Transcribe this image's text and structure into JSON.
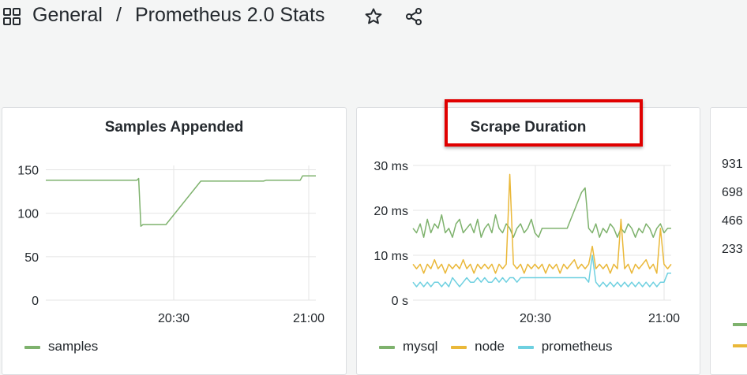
{
  "breadcrumb": {
    "folder": "General",
    "separator": "/",
    "dashboard": "Prometheus 2.0 Stats"
  },
  "colors": {
    "mysql": "#7eb26d",
    "node": "#eab839",
    "prometheus": "#6ed0e0",
    "samples": "#7eb26d",
    "highlight": "#e00000"
  },
  "panels": {
    "samples": {
      "title": "Samples Appended",
      "legend": [
        "samples"
      ],
      "chart_data": {
        "type": "line",
        "x_ticks": [
          "20:30",
          "21:00"
        ],
        "y_ticks": [
          "0",
          "50",
          "100",
          "150"
        ],
        "ylim": [
          0,
          155
        ],
        "series": [
          {
            "name": "samples",
            "points": [
              [
                0,
                138
              ],
              [
                0.337,
                138
              ],
              [
                0.344,
                140
              ],
              [
                0.352,
                85
              ],
              [
                0.36,
                87
              ],
              [
                0.445,
                87
              ],
              [
                0.574,
                137
              ],
              [
                0.806,
                137
              ],
              [
                0.816,
                138
              ],
              [
                0.942,
                138
              ],
              [
                0.951,
                143
              ],
              [
                1,
                143
              ]
            ]
          }
        ]
      }
    },
    "scrape": {
      "title": "Scrape Duration",
      "legend": [
        "mysql",
        "node",
        "prometheus"
      ],
      "chart_data": {
        "type": "line",
        "x_ticks": [
          "20:30",
          "21:00"
        ],
        "y_ticks": [
          "0 s",
          "10 ms",
          "20 ms",
          "30 ms"
        ],
        "ylim": [
          0,
          30
        ],
        "series": [
          {
            "name": "mysql",
            "values": [
              16,
              15,
              17,
              14,
              18,
              15,
              17,
              16,
              19,
              15,
              16,
              14,
              17,
              18,
              15,
              16,
              17,
              15,
              18,
              14,
              16,
              17,
              15,
              19,
              16,
              15,
              17,
              16,
              14,
              16,
              17,
              15,
              16,
              18,
              15,
              14,
              16,
              16,
              16,
              16,
              16,
              16,
              16,
              16,
              18,
              20,
              22,
              24,
              25,
              16,
              15,
              17,
              14,
              16,
              15,
              17,
              16,
              14,
              16,
              15,
              17,
              16,
              14,
              16,
              15,
              17,
              16,
              14,
              16,
              17,
              15,
              16,
              16
            ]
          },
          {
            "name": "node",
            "values": [
              8,
              7,
              8,
              6,
              8,
              7,
              9,
              7,
              8,
              6,
              8,
              7,
              8,
              7,
              9,
              7,
              8,
              6,
              8,
              7,
              8,
              7,
              8,
              6,
              8,
              7,
              8,
              28,
              8,
              7,
              8,
              6,
              8,
              7,
              8,
              7,
              8,
              6,
              8,
              7,
              8,
              6,
              8,
              7,
              8,
              9,
              7,
              8,
              7,
              8,
              12,
              7,
              8,
              7,
              8,
              6,
              8,
              7,
              18,
              7,
              8,
              6,
              8,
              7,
              8,
              9,
              7,
              8,
              6,
              16,
              8,
              7,
              8
            ]
          },
          {
            "name": "prometheus",
            "values": [
              4,
              3,
              4,
              3,
              4,
              3,
              4,
              4,
              3,
              4,
              3,
              5,
              4,
              3,
              4,
              5,
              4,
              4,
              5,
              4,
              5,
              4,
              4,
              5,
              4,
              5,
              4,
              5,
              5,
              4,
              5,
              5,
              5,
              5,
              5,
              5,
              5,
              5,
              5,
              5,
              5,
              5,
              5,
              5,
              5,
              5,
              5,
              5,
              5,
              4,
              10,
              4,
              3,
              4,
              3,
              4,
              3,
              4,
              3,
              4,
              3,
              4,
              3,
              4,
              3,
              4,
              3,
              4,
              3,
              4,
              4,
              6,
              6
            ]
          }
        ]
      }
    },
    "stat": {
      "values": [
        "931",
        "698",
        "466",
        "233"
      ],
      "legend_colors": [
        "#7eb26d",
        "#eab839"
      ]
    }
  }
}
